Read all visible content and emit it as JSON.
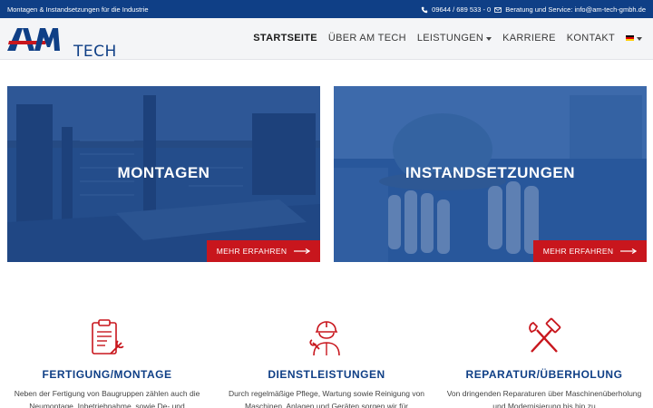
{
  "topbar": {
    "tagline": "Montagen & Instandsetzungen für die Industrie",
    "phone": "09644 / 689 533 - 0",
    "service": "Beratung und Service: info@am-tech-gmbh.de"
  },
  "logo": {
    "tech": "TECH"
  },
  "nav": {
    "items": [
      {
        "label": "STARTSEITE"
      },
      {
        "label": "ÜBER AM TECH"
      },
      {
        "label": "LEISTUNGEN"
      },
      {
        "label": "KARRIERE"
      },
      {
        "label": "KONTAKT"
      }
    ]
  },
  "hero": [
    {
      "title": "MONTAGEN",
      "button": "MEHR ERFAHREN"
    },
    {
      "title": "INSTANDSETZUNGEN",
      "button": "MEHR ERFAHREN"
    }
  ],
  "services": [
    {
      "title": "FERTIGUNG/MONTAGE",
      "text": "Neben der Fertigung von Baugruppen zählen auch die Neumontage, Inbetriebnahme, sowie De- und"
    },
    {
      "title": "DIENSTLEISTUNGEN",
      "text": "Durch regelmäßige Pflege, Wartung sowie Reinigung von Maschinen, Anlagen und Geräten sorgen wir für"
    },
    {
      "title": "REPARATUR/ÜBERHOLUNG",
      "text": "Von dringenden Reparaturen über Maschinenüberholung und Modernisierung bis hin zu"
    }
  ],
  "colors": {
    "brand_blue": "#0f3f86",
    "accent_red": "#c8161d"
  }
}
